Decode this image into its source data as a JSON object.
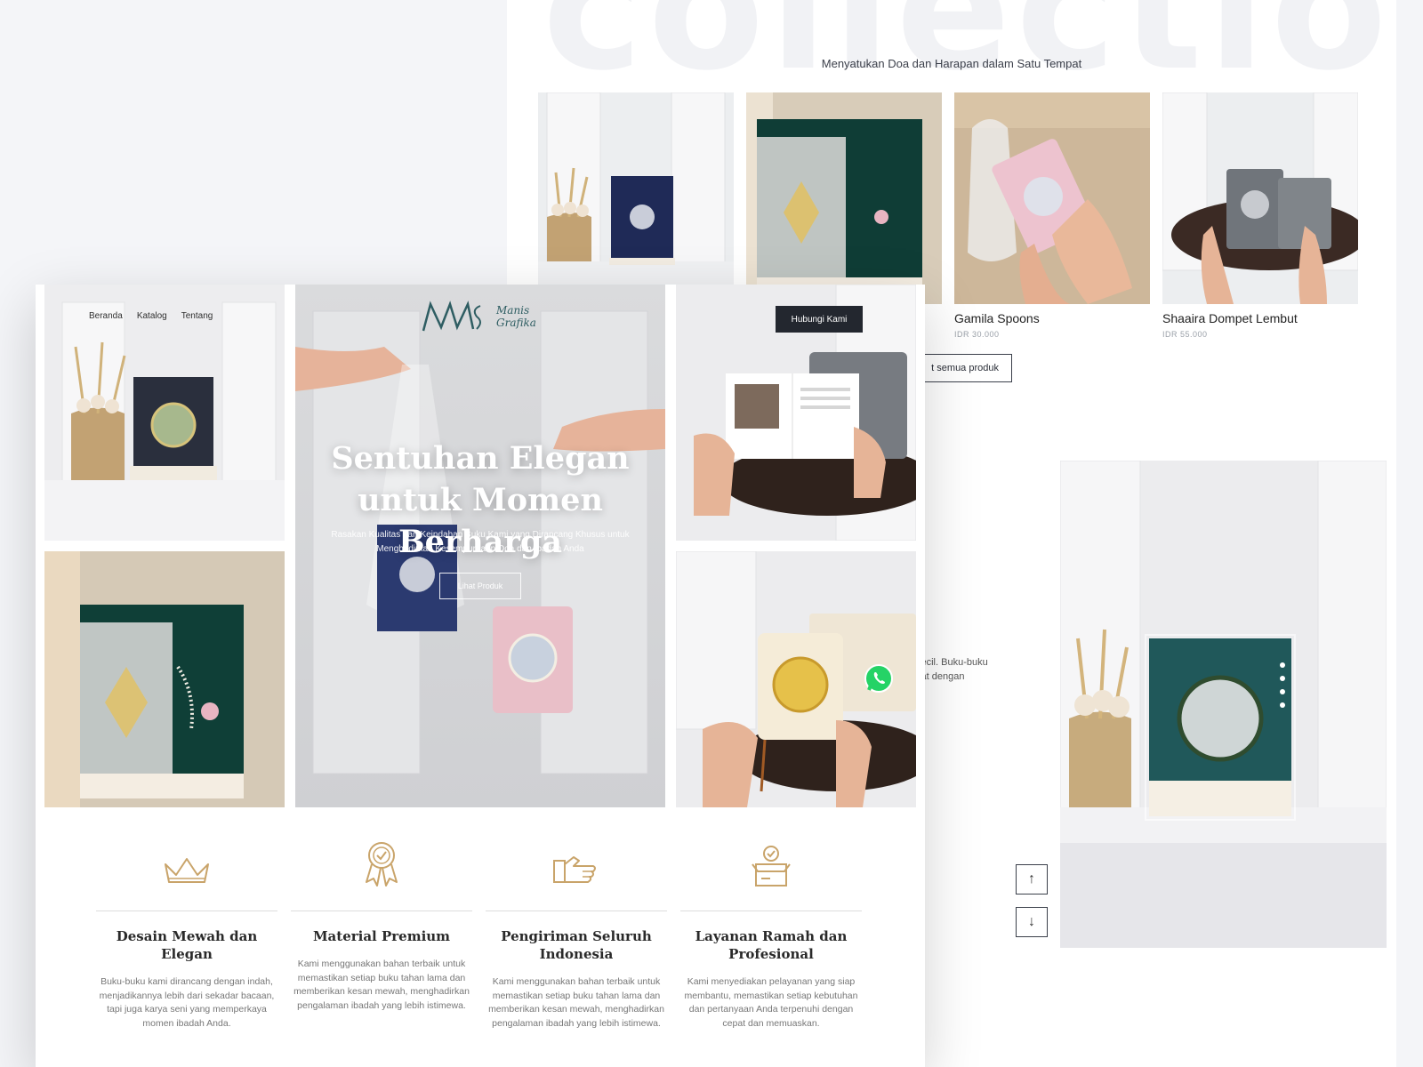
{
  "collection_page": {
    "watermark": "collection",
    "subtitle": "Menyatukan Doa dan Harapan dalam Satu Tempat",
    "products": [
      {
        "name": "",
        "price": ""
      },
      {
        "name": "",
        "price": ""
      },
      {
        "name": "Gamila Spoons",
        "price": "IDR 30.000"
      },
      {
        "name": "Shaaira Dompet Lembut",
        "price": "IDR 55.000"
      }
    ],
    "see_all": "t semua produk",
    "about_line1": "kecil. Buku-buku",
    "about_line2": "kat dengan",
    "arrow_up": "↑",
    "arrow_down": "↓"
  },
  "landing": {
    "nav": [
      "Beranda",
      "Katalog",
      "Tentang"
    ],
    "logo_line1": "Manis",
    "logo_line2": "Grafika",
    "cta": "Hubungi Kami",
    "hero": {
      "title": "Sentuhan Elegan untuk Momen Berharga",
      "subtitle": "Rasakan Kualitas dan Keindahan Buku Kami yang Dirancang Khusus untuk Menghadirkan Kesempurnaan Doa dan Ibadah Anda",
      "button": "Lihat Produk"
    },
    "features": [
      {
        "icon": "crown-icon",
        "title": "Desain Mewah dan Elegan",
        "text": "Buku-buku kami dirancang dengan indah, menjadikannya lebih dari sekadar bacaan, tapi juga karya seni yang memperkaya momen ibadah Anda."
      },
      {
        "icon": "award-badge-icon",
        "title": "Material Premium",
        "text": "Kami menggunakan bahan terbaik untuk memastikan setiap buku tahan lama dan memberikan kesan mewah, menghadirkan pengalaman ibadah yang lebih istimewa."
      },
      {
        "icon": "handshake-icon",
        "title": "Pengiriman Seluruh Indonesia",
        "text": "Kami menggunakan bahan terbaik untuk memastikan setiap buku tahan lama dan memberikan kesan mewah, menghadirkan pengalaman ibadah yang lebih istimewa."
      },
      {
        "icon": "delivery-box-icon",
        "title": "Layanan Ramah dan Profesional",
        "text": "Kami menyediakan pelayanan yang siap membantu, memastikan setiap kebutuhan dan pertanyaan Anda terpenuhi dengan cepat dan memuaskan."
      }
    ]
  },
  "colors": {
    "accent_gold": "#c9a46a",
    "dark_button": "#23272f",
    "logo_teal": "#2e5d62"
  }
}
